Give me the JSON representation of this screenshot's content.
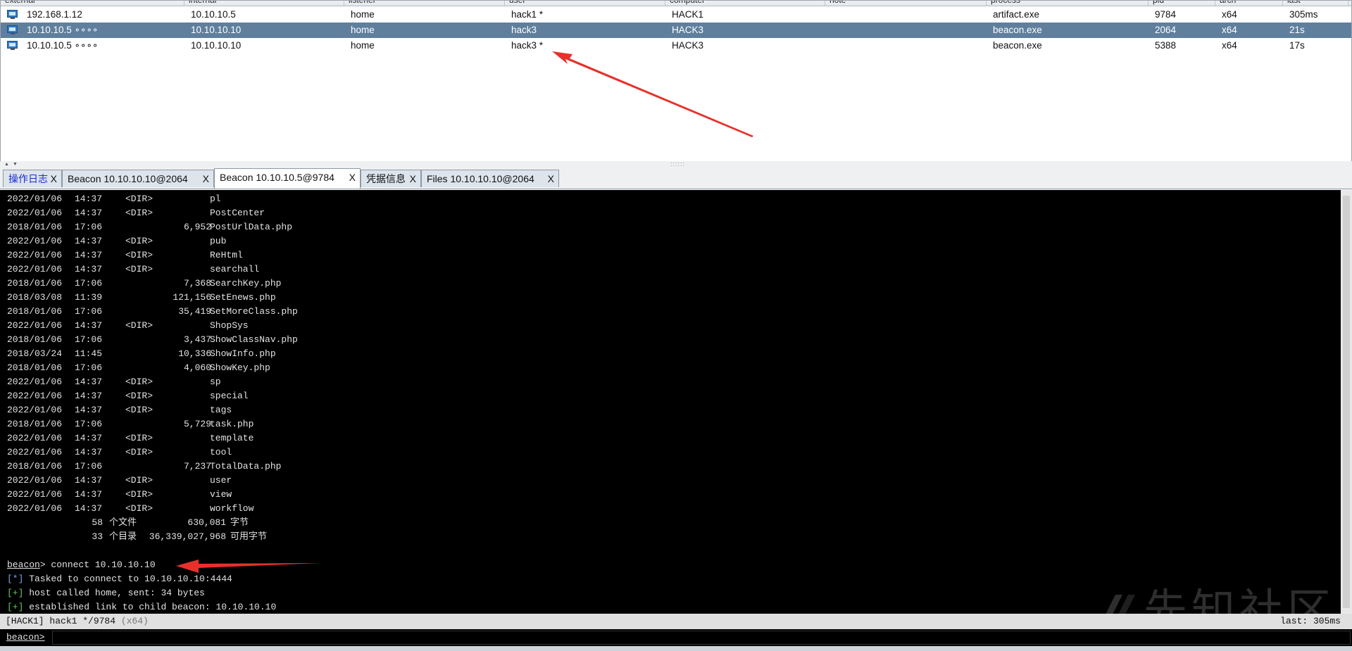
{
  "sessions": {
    "columns": [
      "external",
      "internal",
      "listener",
      "user",
      "computer",
      "note",
      "process",
      "pid",
      "arch",
      "last"
    ],
    "rows": [
      {
        "external": "192.168.1.12",
        "internal": "10.10.10.5",
        "listener": "home",
        "user": "hack1 *",
        "computer": "HACK1",
        "note": "",
        "process": "artifact.exe",
        "pid": "9784",
        "arch": "x64",
        "last": "305ms",
        "selected": false
      },
      {
        "external": "10.10.10.5 ∘∘∘∘",
        "internal": "10.10.10.10",
        "listener": "home",
        "user": "hack3",
        "computer": "HACK3",
        "note": "",
        "process": "beacon.exe",
        "pid": "2064",
        "arch": "x64",
        "last": "21s",
        "selected": true
      },
      {
        "external": "10.10.10.5 ∘∘∘∘",
        "internal": "10.10.10.10",
        "listener": "home",
        "user": "hack3 *",
        "computer": "HACK3",
        "note": "",
        "process": "beacon.exe",
        "pid": "5388",
        "arch": "x64",
        "last": "17s",
        "selected": false
      }
    ]
  },
  "splitter": {
    "up": "▲",
    "down": "▼",
    "grip": "::::::"
  },
  "tabs": [
    {
      "label": "操作日志",
      "close": "X",
      "active": false
    },
    {
      "label": "Beacon 10.10.10.10@2064",
      "close": "X",
      "active": false
    },
    {
      "label": "Beacon 10.10.10.5@9784",
      "close": "X",
      "active": true
    },
    {
      "label": "凭据信息",
      "close": "X",
      "active": false
    },
    {
      "label": "Files 10.10.10.10@2064",
      "close": "X",
      "active": false
    }
  ],
  "console": {
    "listing": [
      [
        "2022/01/06",
        "14:37",
        "<DIR>",
        "",
        "pl"
      ],
      [
        "2022/01/06",
        "14:37",
        "<DIR>",
        "",
        "PostCenter"
      ],
      [
        "2018/01/06",
        "17:06",
        "",
        "6,952",
        "PostUrlData.php"
      ],
      [
        "2022/01/06",
        "14:37",
        "<DIR>",
        "",
        "pub"
      ],
      [
        "2022/01/06",
        "14:37",
        "<DIR>",
        "",
        "ReHtml"
      ],
      [
        "2022/01/06",
        "14:37",
        "<DIR>",
        "",
        "searchall"
      ],
      [
        "2018/01/06",
        "17:06",
        "",
        "7,368",
        "SearchKey.php"
      ],
      [
        "2018/03/08",
        "11:39",
        "",
        "121,156",
        "SetEnews.php"
      ],
      [
        "2018/01/06",
        "17:06",
        "",
        "35,419",
        "SetMoreClass.php"
      ],
      [
        "2022/01/06",
        "14:37",
        "<DIR>",
        "",
        "ShopSys"
      ],
      [
        "2018/01/06",
        "17:06",
        "",
        "3,437",
        "ShowClassNav.php"
      ],
      [
        "2018/03/24",
        "11:45",
        "",
        "10,336",
        "ShowInfo.php"
      ],
      [
        "2018/01/06",
        "17:06",
        "",
        "4,060",
        "ShowKey.php"
      ],
      [
        "2022/01/06",
        "14:37",
        "<DIR>",
        "",
        "sp"
      ],
      [
        "2022/01/06",
        "14:37",
        "<DIR>",
        "",
        "special"
      ],
      [
        "2022/01/06",
        "14:37",
        "<DIR>",
        "",
        "tags"
      ],
      [
        "2018/01/06",
        "17:06",
        "",
        "5,729",
        "task.php"
      ],
      [
        "2022/01/06",
        "14:37",
        "<DIR>",
        "",
        "template"
      ],
      [
        "2022/01/06",
        "14:37",
        "<DIR>",
        "",
        "tool"
      ],
      [
        "2018/01/06",
        "17:06",
        "",
        "7,237",
        "TotalData.php"
      ],
      [
        "2022/01/06",
        "14:37",
        "<DIR>",
        "",
        "user"
      ],
      [
        "2022/01/06",
        "14:37",
        "<DIR>",
        "",
        "view"
      ],
      [
        "2022/01/06",
        "14:37",
        "<DIR>",
        "",
        "workflow"
      ]
    ],
    "summary": [
      {
        "count": "58",
        "label": "个文件",
        "size": "630,081",
        "unit": "字节"
      },
      {
        "count": "33",
        "label": "个目录",
        "size": "36,339,027,968",
        "unit": "可用字节"
      }
    ],
    "prompt": "beacon",
    "command": "> connect 10.10.10.10",
    "messages": [
      {
        "tag": "[*]",
        "text": " Tasked to connect to 10.10.10.10:4444",
        "type": "info"
      },
      {
        "tag": "[+]",
        "text": " host called home, sent: 34 bytes",
        "type": "ok"
      },
      {
        "tag": "[+]",
        "text": " established link to child beacon: 10.10.10.10",
        "type": "ok"
      }
    ]
  },
  "status": {
    "host": "[HACK1]",
    "user_pid": " hack1 */9784 ",
    "arch": "(x64)",
    "last": "last: 305ms"
  },
  "input": {
    "prompt": "beacon>",
    "value": ""
  },
  "watermark": "先知社区",
  "colors": {
    "selected_row": "#5f7f9d",
    "console_bg": "#000000",
    "annotation": "#e8302a",
    "info_tag": "#7aa3e8",
    "ok_tag": "#60c85e"
  }
}
